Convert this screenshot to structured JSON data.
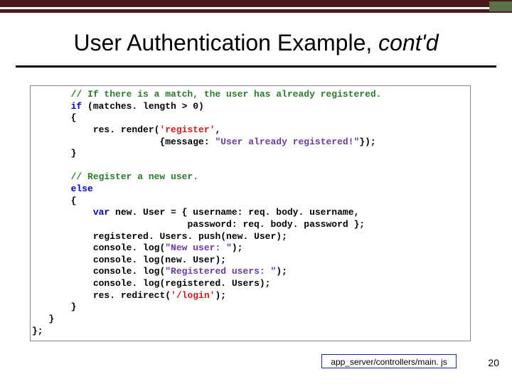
{
  "title": {
    "main": "User Authentication Example, ",
    "italic": "cont'd"
  },
  "code": {
    "indent": "       ",
    "indent0b": "   ",
    "indent2": "           ",
    "indent4": "                       ",
    "indent5": "                            ",
    "blank": " ",
    "ob": "{",
    "cb": "}",
    "kw_if": "if",
    "kw_else": "else",
    "kw_var": "var",
    "l1": "// If there is a match, the user has already registered.",
    "l2_rest": " (matches. length > 0)",
    "l4a": "res. render(",
    "l4b": "'register'",
    "l4c": ",",
    "l5a": "{message: ",
    "l5b": "\"User already registered!\"",
    "l5c": "});",
    "l8": "// Register a new user.",
    "l11": " new. User = { username: req. body. username,",
    "l12": "password: req. body. password };",
    "l13": "registered. Users. push(new. User);",
    "l14a": "console. log(",
    "l14b": "\"New user: \"",
    "l14c": ");",
    "l15": "console. log(new. User);",
    "l16a": "console. log(",
    "l16b": "\"Registered users: \"",
    "l16c": ");",
    "l17": "console. log(registered. Users);",
    "l18a": "res. redirect(",
    "l18b": "'/login'",
    "l18c": ");",
    "l21": "};"
  },
  "footer": {
    "filepath": "app_server/controllers/main. js",
    "page": "20"
  }
}
